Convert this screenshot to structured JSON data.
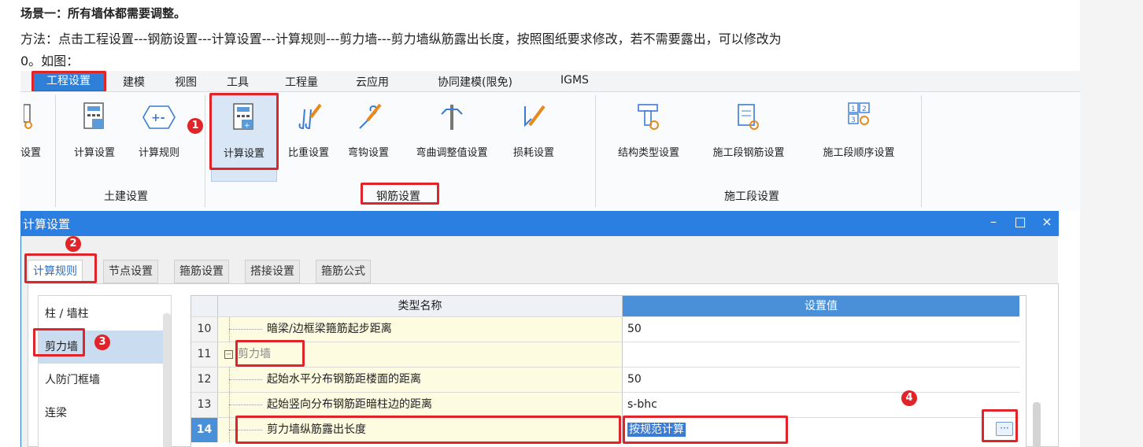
{
  "article": {
    "heading": "场景一：所有墙体都需要调整。",
    "line1": "方法：点击工程设置---钢筋设置---计算设置---计算规则---剪力墙---剪力墙纵筋露出长度，按照图纸要求修改，若不需要露出，可以修改为",
    "line2": "0。如图："
  },
  "menubar": {
    "items": [
      "工程设置",
      "建模",
      "视图",
      "工具",
      "工程量",
      "云应用",
      "协同建模(限免)",
      "IGMS"
    ]
  },
  "toolbar": {
    "partial_label": "设置",
    "civil": {
      "label": "土建设置",
      "tools": [
        "计算设置",
        "计算规则"
      ]
    },
    "rebar": {
      "label": "钢筋设置",
      "tools": [
        "计算设置",
        "比重设置",
        "弯钩设置",
        "弯曲调整值设置",
        "损耗设置"
      ]
    },
    "construction": {
      "label": "施工段设置",
      "tools": [
        "结构类型设置",
        "施工段钢筋设置",
        "施工段顺序设置"
      ]
    }
  },
  "dialog": {
    "title": "计算设置",
    "minimize": "–",
    "maximize": "□",
    "close": "×",
    "tabs": [
      "计算规则",
      "节点设置",
      "箍筋设置",
      "搭接设置",
      "箍筋公式"
    ],
    "nav": [
      "柱 / 墙柱",
      "剪力墙",
      "人防门框墙",
      "连梁"
    ],
    "grid": {
      "col_type": "类型名称",
      "col_value": "设置值",
      "rows": [
        {
          "num": "10",
          "name": "暗梁/边框梁箍筋起步距离",
          "value": "50"
        },
        {
          "num": "11",
          "name": "剪力墙",
          "value": "",
          "expander": "−"
        },
        {
          "num": "12",
          "name": "起始水平分布钢筋距楼面的距离",
          "value": "50"
        },
        {
          "num": "13",
          "name": "起始竖向分布钢筋距暗柱边的距离",
          "value": "s-bhc"
        },
        {
          "num": "14",
          "name": "剪力墙纵筋露出长度",
          "value": "按规范计算",
          "button": "···"
        }
      ]
    }
  },
  "badges": [
    "1",
    "2",
    "3",
    "4"
  ],
  "colors": {
    "accent": "#2b7fe0",
    "highlight_red": "#e0242a",
    "row_yellow": "#fdfbe0",
    "selection": "#3a7bd5"
  }
}
